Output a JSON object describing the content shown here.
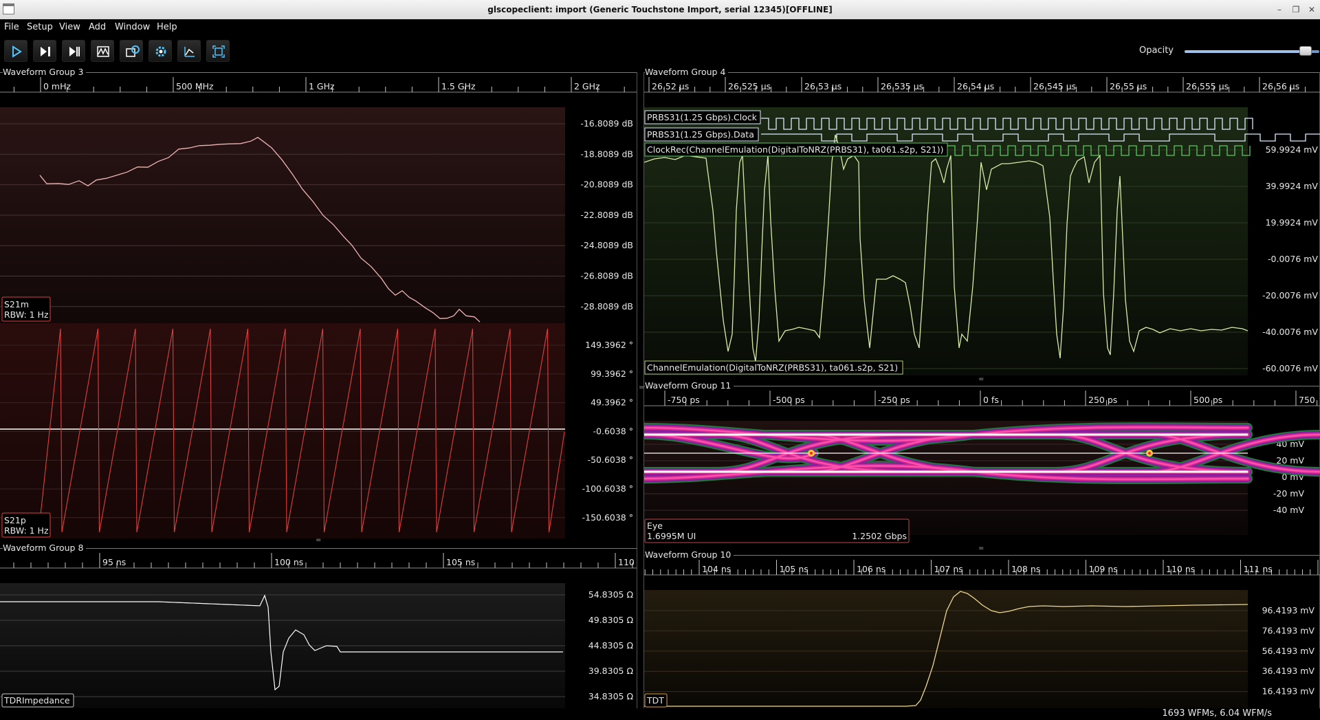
{
  "window": {
    "title": "glscopeclient: import (Generic Touchstone Import, serial 12345)[OFFLINE]"
  },
  "menu": [
    "File",
    "Setup",
    "View",
    "Add",
    "Window",
    "Help"
  ],
  "toolbar": {
    "buttons": [
      {
        "name": "start-trigger-button",
        "icon": "play-icon"
      },
      {
        "name": "single-trigger-button",
        "icon": "step-icon"
      },
      {
        "name": "force-trigger-button",
        "icon": "force-icon"
      },
      {
        "name": "history-button",
        "icon": "history-icon"
      },
      {
        "name": "refresh-settings-button",
        "icon": "refresh-icon"
      },
      {
        "name": "clear-sweeps-button",
        "icon": "gear-icon"
      },
      {
        "name": "fullscreen-button",
        "icon": "zoom-icon"
      },
      {
        "name": "autoscale-button",
        "icon": "autoscale-icon"
      }
    ],
    "opacity_label": "Opacity",
    "opacity_value": 0.9,
    "icon_color": "#4fc6ff"
  },
  "groups": {
    "g3": {
      "title": "Waveform Group 3",
      "ticks": [
        "0 mHz",
        "500 MHz",
        "1 GHz",
        "1.5 GHz",
        "2 GHz"
      ],
      "waves": [
        {
          "name": "S21m",
          "rbw": "RBW: 1 Hz",
          "color": "#f0b4b4",
          "y_labels": [
            "-16.8089 dB",
            "-18.8089 dB",
            "-20.8089 dB",
            "-22.8089 dB",
            "-24.8089 dB",
            "-26.8089 dB",
            "-28.8089 dB"
          ]
        },
        {
          "name": "S21p",
          "rbw": "RBW: 1 Hz",
          "color": "#e04040",
          "y_labels": [
            "149.3962 °",
            "99.3962 °",
            "49.3962 °",
            "-0.6038 °",
            "-50.6038 °",
            "-100.6038 °",
            "-150.6038 °"
          ]
        }
      ]
    },
    "g4": {
      "title": "Waveform Group 4",
      "ticks": [
        "26.52 µs",
        "26.525 µs",
        "26.53 µs",
        "26.535 µs",
        "26.54 µs",
        "26.545 µs",
        "26.55 µs",
        "26.555 µs",
        "26.56 µs"
      ],
      "digital": [
        "PRBS31(1.25 Gbps).Clock",
        "PRBS31(1.25 Gbps).Data",
        "ClockRec(ChannelEmulation(DigitalToNRZ(PRBS31), ta061.s2p, S21))"
      ],
      "analog_name": "ChannelEmulation(DigitalToNRZ(PRBS31), ta061.s2p, S21)",
      "analog_color": "#d8eca8",
      "y_labels": [
        "59.9924 mV",
        "39.9924 mV",
        "19.9924 mV",
        "-0.0076 mV",
        "-20.0076 mV",
        "-40.0076 mV",
        "-60.0076 mV"
      ]
    },
    "g11": {
      "title": "Waveform Group 11",
      "ticks": [
        "-750 ps",
        "-500 ps",
        "-250 ps",
        "0 fs",
        "250 ps",
        "500 ps",
        "750"
      ],
      "eye_name": "Eye",
      "eye_ui": "1.6995M UI",
      "eye_rate": "1.2502 Gbps",
      "y_labels": [
        "40 mV",
        "20 mV",
        "0 mV",
        "-20 mV",
        "-40 mV"
      ]
    },
    "g8": {
      "title": "Waveform Group 8",
      "ticks": [
        "95 ns",
        "100 ns",
        "105 ns",
        "110"
      ],
      "wave_name": "TDRImpedance",
      "y_labels": [
        "54.8305 Ω",
        "49.8305 Ω",
        "44.8305 Ω",
        "39.8305 Ω",
        "34.8305 Ω"
      ]
    },
    "g10": {
      "title": "Waveform Group 10",
      "ticks": [
        "104 ns",
        "105 ns",
        "106 ns",
        "107 ns",
        "108 ns",
        "109 ns",
        "110 ns",
        "111 ns"
      ],
      "wave_name": "TDT",
      "wave_color": "#f0d890",
      "y_labels": [
        "96.4193 mV",
        "76.4193 mV",
        "56.4193 mV",
        "36.4193 mV",
        "16.4193 mV"
      ]
    }
  },
  "status": {
    "text": "1693 WFMs, 6.04 WFM/s"
  }
}
